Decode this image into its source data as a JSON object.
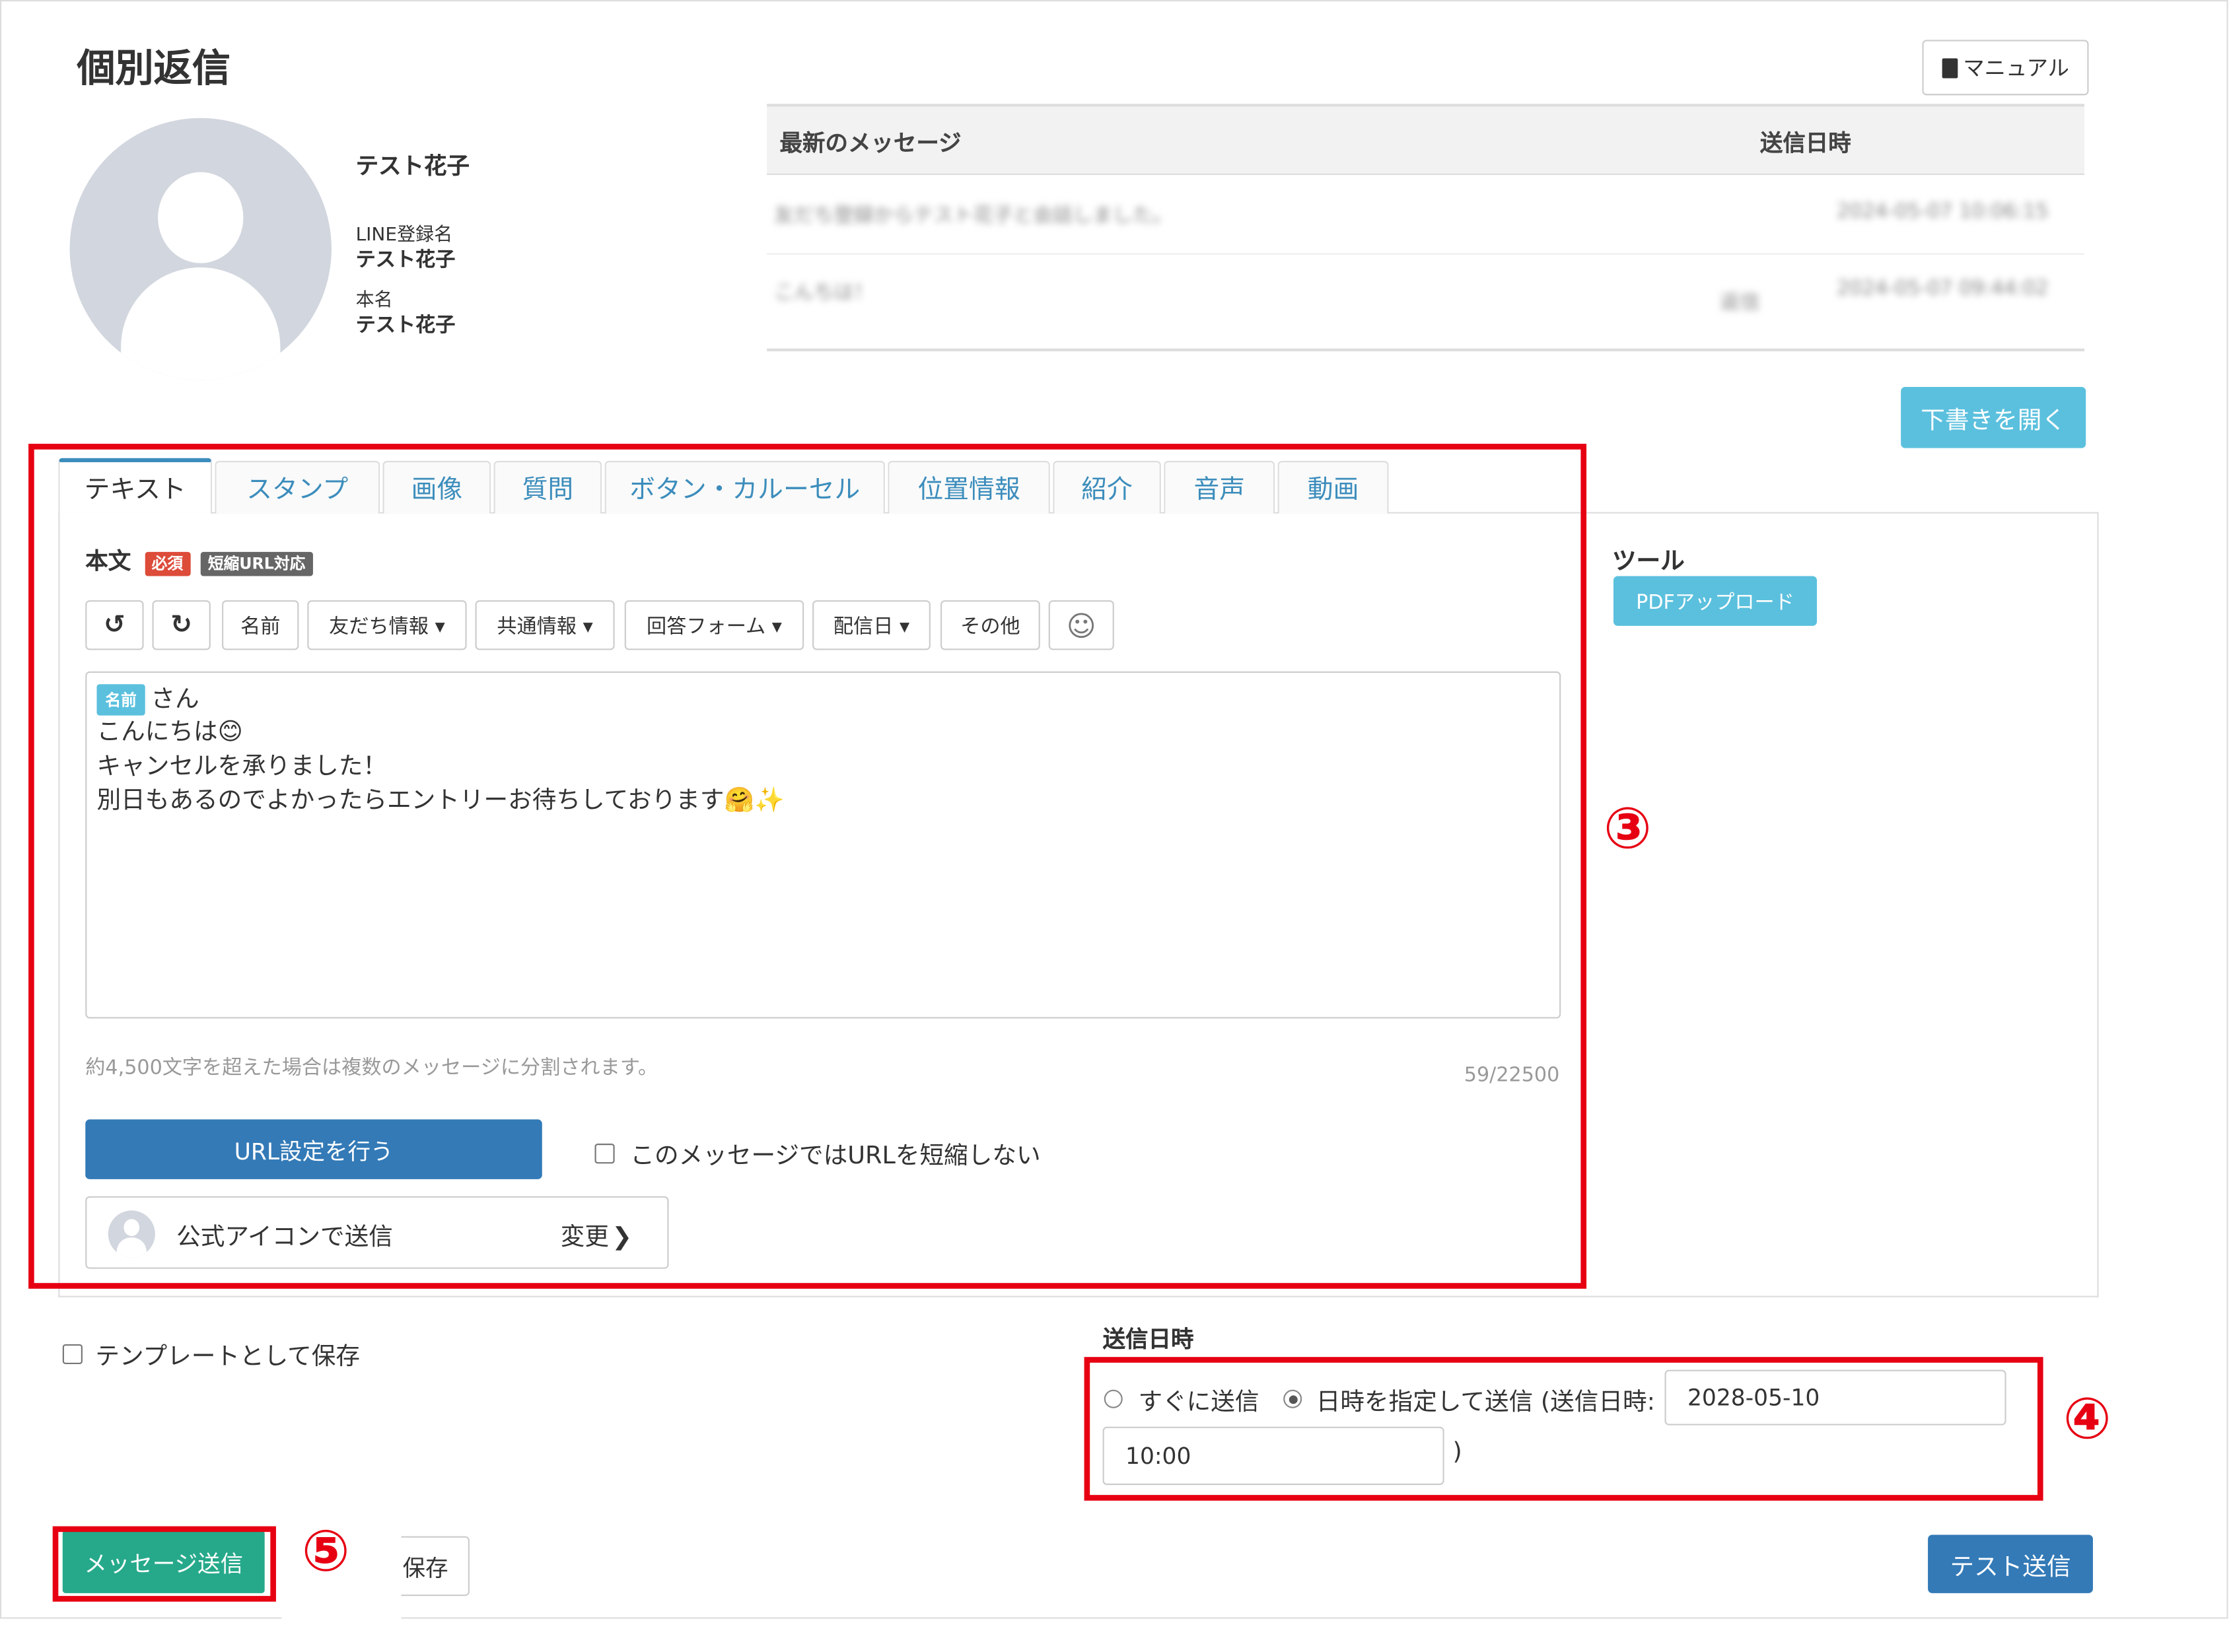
{
  "page": {
    "title": "個別返信",
    "manual_label": "マニュアル"
  },
  "profile": {
    "display_name": "テスト花子",
    "line_name_label": "LINE登録名",
    "line_name": "テスト花子",
    "real_name_label": "本名",
    "real_name": "テスト花子"
  },
  "recent_messages": {
    "header_message": "最新のメッセージ",
    "header_datetime": "送信日時",
    "rows": [
      {
        "text": "友だち登録からテスト花子と会話しました。",
        "datetime": "2024-05-07 10:06:15",
        "tag": ""
      },
      {
        "text": "こんちは！",
        "datetime": "2024-05-07 09:44:02",
        "tag": "返信"
      }
    ]
  },
  "draft_button": "下書きを開く",
  "tabs": [
    "テキスト",
    "スタンプ",
    "画像",
    "質問",
    "ボタン・カルーセル",
    "位置情報",
    "紹介",
    "音声",
    "動画"
  ],
  "editor": {
    "body_label": "本文",
    "required_badge": "必須",
    "shorturl_badge": "短縮URL対応",
    "toolbar": {
      "undo": "↺",
      "redo": "↻",
      "name": "名前",
      "friend_info": "友だち情報 ▾",
      "common_info": "共通情報 ▾",
      "answer_form": "回答フォーム ▾",
      "delivery_date": "配信日 ▾",
      "other": "その他",
      "emoji": "☺"
    },
    "name_chip": "名前",
    "lines": [
      "さん",
      "こんにちは😊",
      "キャンセルを承りました！",
      "別日もあるのでよかったらエントリーお待ちしております🤗✨"
    ],
    "hint": "約4,500文字を超えた場合は複数のメッセージに分割されます。",
    "char_count": "59/22500",
    "url_button": "URL設定を行う",
    "no_shorten_label": "このメッセージではURLを短縮しない",
    "icon_send_label": "公式アイコンで送信",
    "change_label": "変更"
  },
  "tools": {
    "heading": "ツール",
    "pdf_upload": "PDFアップロード"
  },
  "template_save_label": "テンプレートとして保存",
  "schedule": {
    "heading": "送信日時",
    "immediate_label": "すぐに送信",
    "scheduled_label": "日時を指定して送信 (送信日時:",
    "date": "2028-05-10",
    "time": "10:00",
    "close_paren": ")"
  },
  "annotations": {
    "n3": "③",
    "n4": "④",
    "n5": "⑤",
    "color": "#e60012"
  },
  "buttons": {
    "send": "メッセージ送信",
    "save": "保存",
    "test_send": "テスト送信"
  }
}
